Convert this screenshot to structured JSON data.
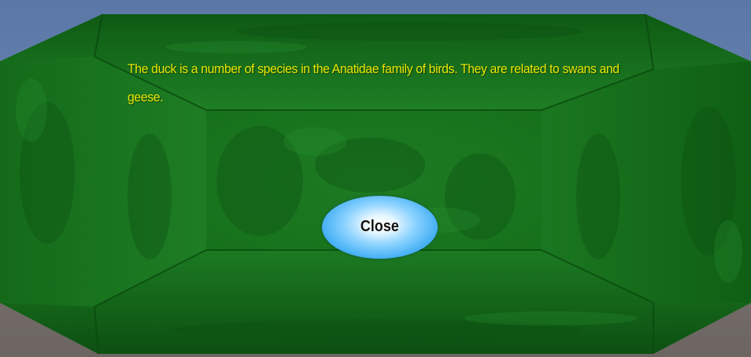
{
  "dialog": {
    "message": "The duck is a number of species in the Anatidae family of birds. They are related to swans and geese.",
    "close_label": "Close"
  },
  "colors": {
    "panel_green": "#1f7a26",
    "panel_dark": "#0f5514",
    "text_yellow": "#e8e600",
    "button_blue": "#45b0f5",
    "sky": "#6a86b4",
    "ground": "#6e6a66"
  }
}
